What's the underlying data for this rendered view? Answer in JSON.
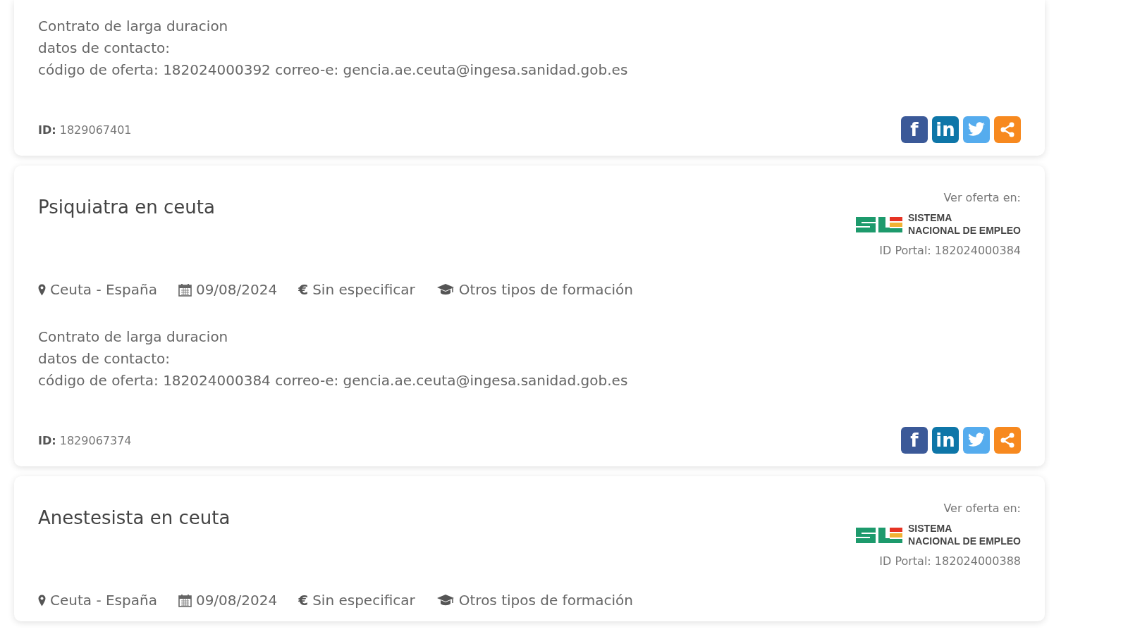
{
  "offers": [
    {
      "description": [
        "Contrato de larga duracion",
        "datos de contacto:",
        "código de oferta: 182024000392 correo-e: gencia.ae.ceuta@ingesa.sanidad.gob.es"
      ],
      "id_label": "ID:",
      "id": "1829067401",
      "share": [
        {
          "kind": "facebook",
          "glyph": "f"
        },
        {
          "kind": "linkedin",
          "glyph": "in"
        },
        {
          "kind": "twitter"
        },
        {
          "kind": "share"
        }
      ]
    },
    {
      "title": "Psiquiatra en ceuta",
      "source": {
        "label": "Ver oferta en:",
        "logo_lines": [
          "SISTEMA",
          "NACIONAL DE EMPLEO"
        ],
        "portal_id": "ID Portal: 182024000384"
      },
      "meta": [
        {
          "kind": "location",
          "text": "Ceuta - España"
        },
        {
          "kind": "date",
          "text": "09/08/2024"
        },
        {
          "kind": "salary",
          "symbol": "€",
          "text": "Sin especificar"
        },
        {
          "kind": "education",
          "text": "Otros tipos de formación"
        }
      ],
      "description": [
        "Contrato de larga duracion",
        "datos de contacto:",
        "código de oferta: 182024000384 correo-e: gencia.ae.ceuta@ingesa.sanidad.gob.es"
      ],
      "id_label": "ID:",
      "id": "1829067374",
      "share": [
        {
          "kind": "facebook",
          "glyph": "f"
        },
        {
          "kind": "linkedin",
          "glyph": "in"
        },
        {
          "kind": "twitter"
        },
        {
          "kind": "share"
        }
      ]
    },
    {
      "title": "Anestesista en ceuta",
      "source": {
        "label": "Ver oferta en:",
        "logo_lines": [
          "SISTEMA",
          "NACIONAL DE EMPLEO"
        ],
        "portal_id": "ID Portal: 182024000388"
      },
      "meta": [
        {
          "kind": "location",
          "text": "Ceuta - España"
        },
        {
          "kind": "date",
          "text": "09/08/2024"
        },
        {
          "kind": "salary",
          "symbol": "€",
          "text": "Sin especificar"
        },
        {
          "kind": "education",
          "text": "Otros tipos de formación"
        }
      ]
    }
  ]
}
